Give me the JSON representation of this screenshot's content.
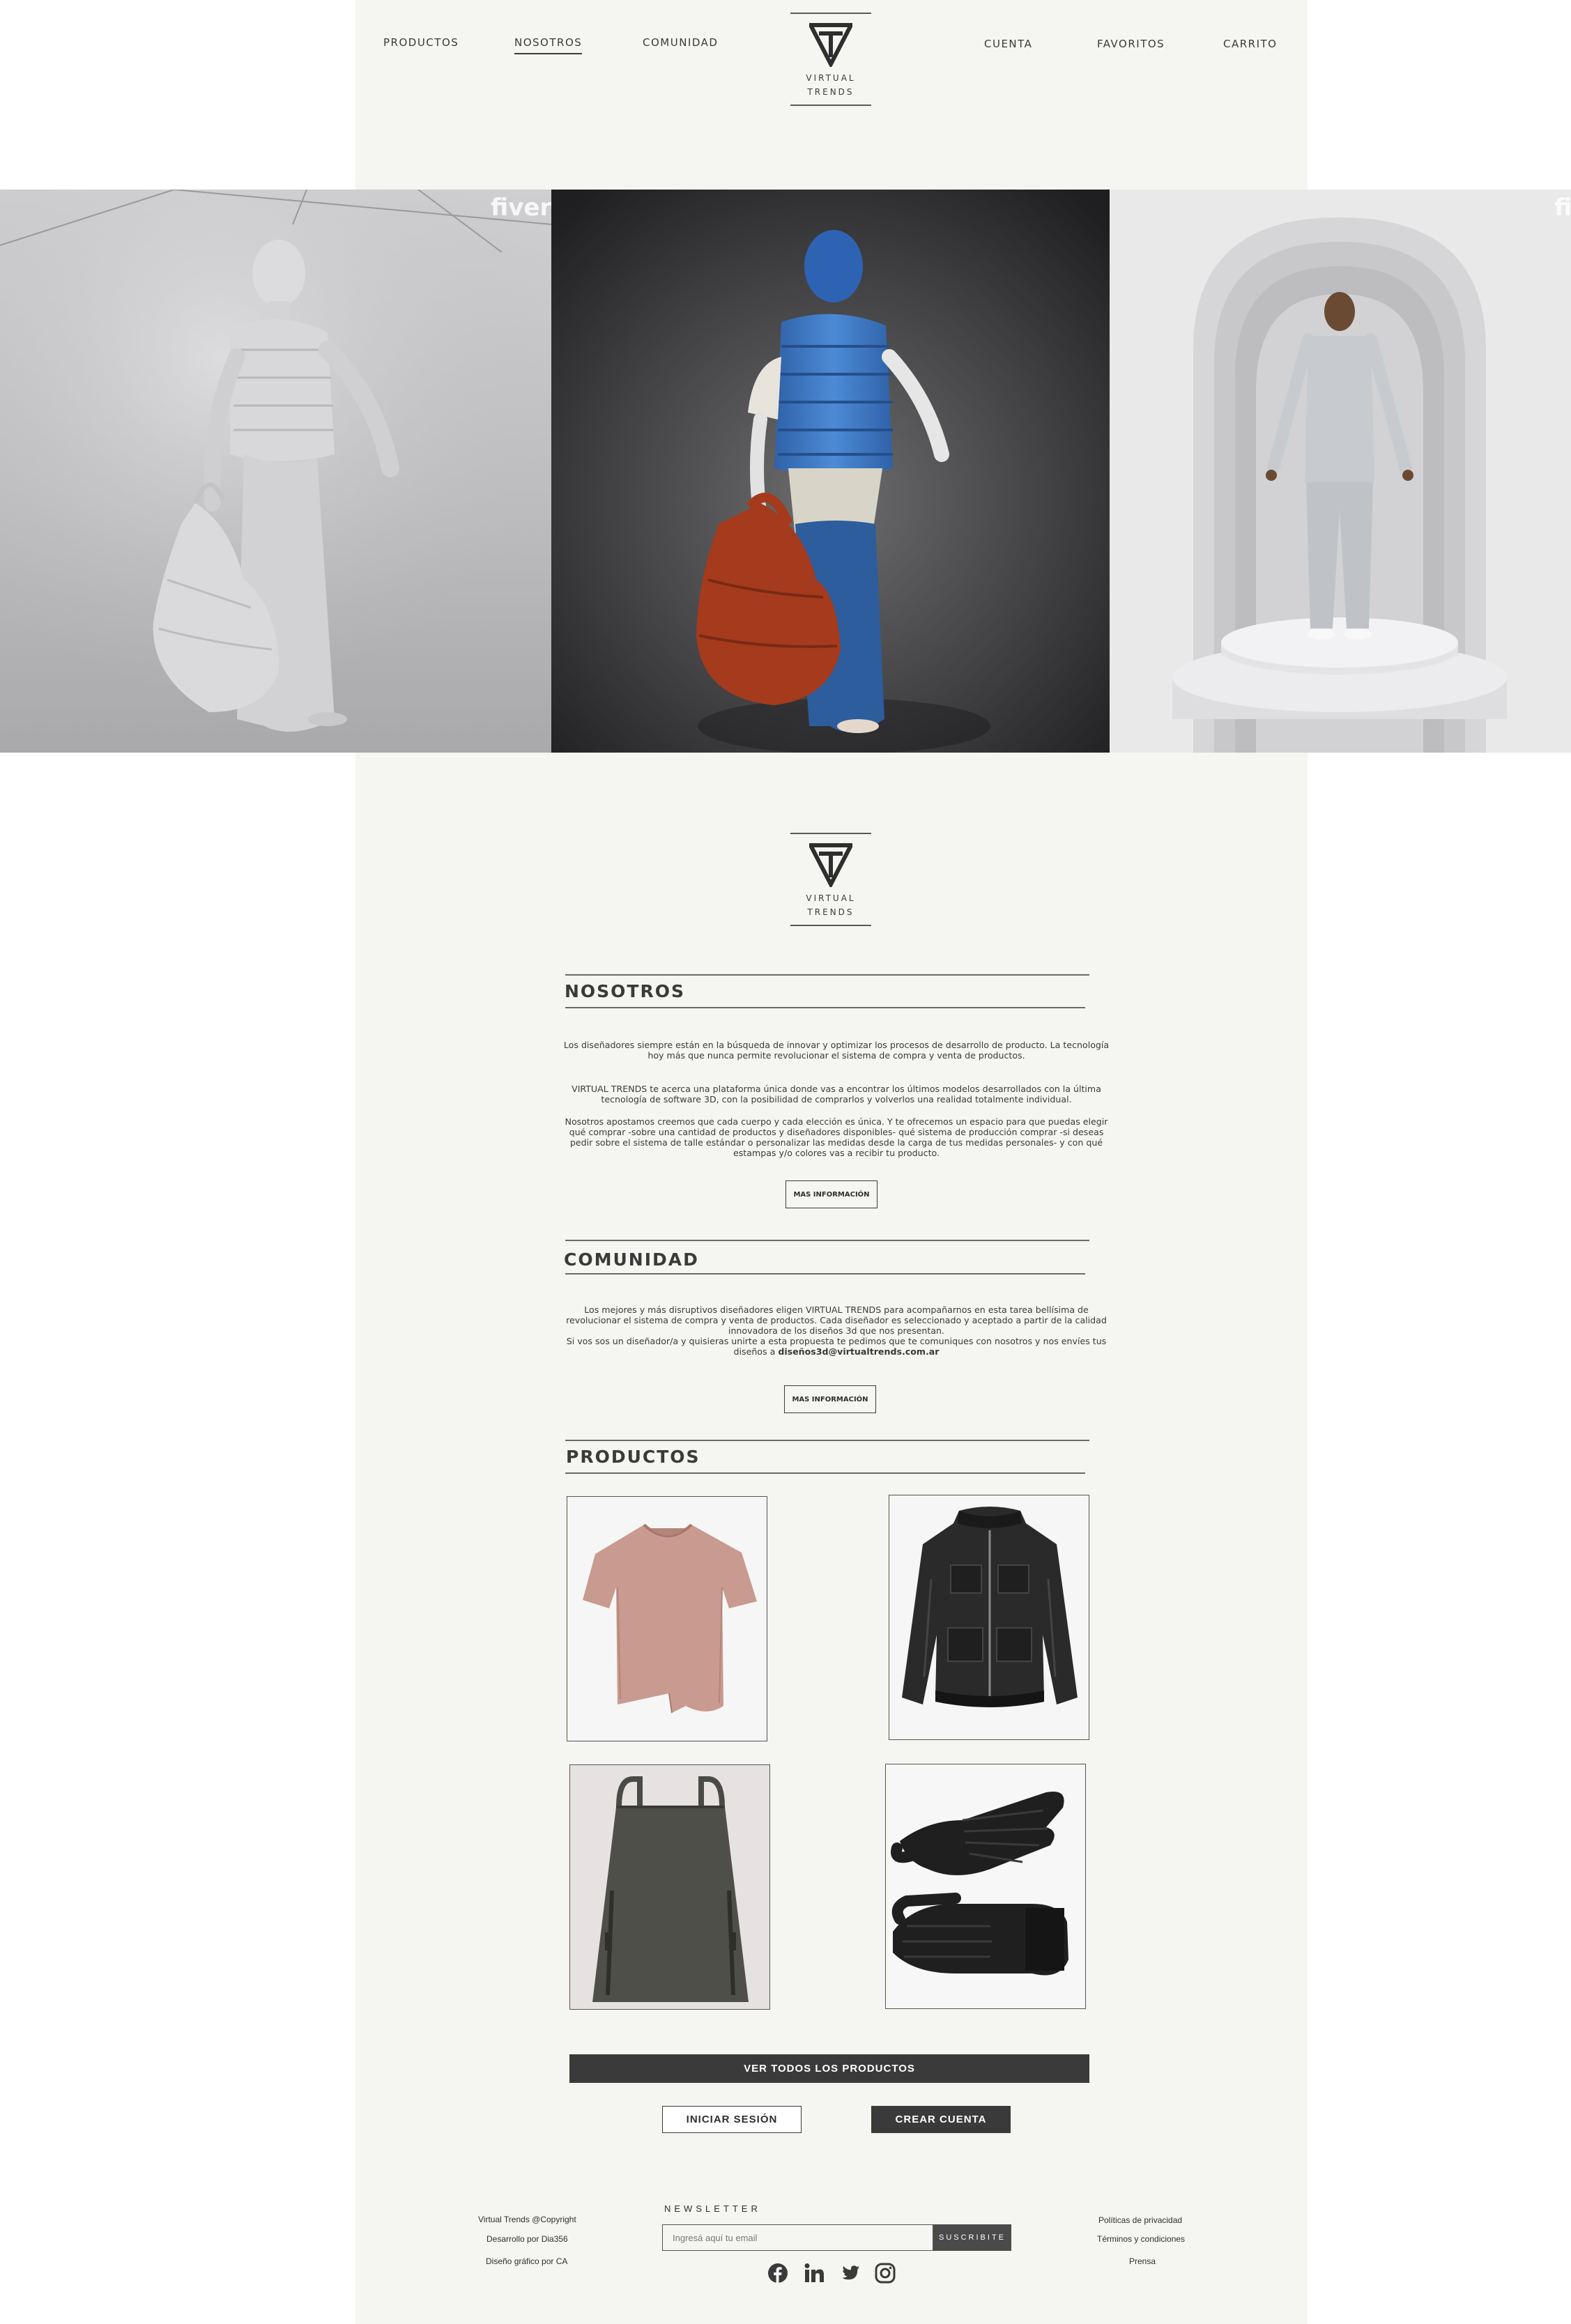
{
  "nav": {
    "left": [
      "PRODUCTOS",
      "NOSOTROS",
      "COMUNIDAD"
    ],
    "right": [
      "CUENTA",
      "FAVORITOS",
      "CARRITO"
    ],
    "active": "NOSOTROS"
  },
  "logo": {
    "line1": "VIRTUAL",
    "line2": "TRENDS"
  },
  "hero": {
    "watermark": "fiverr."
  },
  "nosotros": {
    "title": "NOSOTROS",
    "p1": "Los diseñadores siempre están en la búsqueda de innovar y optimizar los procesos de desarrollo de producto. La tecnología hoy más que nunca permite revolucionar el sistema de compra y venta de productos.",
    "p2": "VIRTUAL TRENDS te acerca una plataforma única donde vas a encontrar los últimos modelos desarrollados con la última tecnología de software 3D, con la posibilidad de comprarlos y volverlos una realidad totalmente individual.",
    "p3": "Nosotros apostamos creemos que cada cuerpo y cada elección es única. Y te ofrecemos un espacio para que puedas elegir qué comprar -sobre una cantidad de productos y diseñadores disponibles- qué sistema de producción comprar -si deseas pedir sobre el sistema de talle estándar o personalizar las medidas desde la carga de tus medidas personales- y con qué estampas y/o colores vas a recibir tu producto.",
    "button": "MAS INFORMACIÓN"
  },
  "comunidad": {
    "title": "COMUNIDAD",
    "p1": "Los mejores y más disruptivos diseñadores eligen VIRTUAL TRENDS para acompañarnos en esta tarea bellísima de revolucionar el sistema de compra y venta de productos. Cada diseñador es seleccionado y aceptado a partir de la calidad innovadora de los diseños 3d que nos presentan.",
    "p2": "Si vos sos un diseñador/a y quisieras unirte a esta propuesta te pedimos que te comuniques con nosotros y nos envíes tus diseños a",
    "email": "diseños3d@virtualtrends.com.ar",
    "button": "MAS INFORMACIÓN"
  },
  "productos": {
    "title": "PRODUCTOS",
    "items": [
      "t-shirt",
      "leather-jacket",
      "backpack",
      "gloves"
    ],
    "view_all": "VER TODOS LOS PRODUCTOS"
  },
  "auth": {
    "login": "INICIAR SESIÓN",
    "signup": "CREAR CUENTA"
  },
  "footer": {
    "left": [
      "Virtual Trends @Copyright",
      "Desarrollo por Dia356",
      "Diseño gráfico por CA"
    ],
    "newsletter_title": "NEWSLETTER",
    "newsletter_placeholder": "Ingresá aquí tu email",
    "newsletter_button": "SUSCRIBITE",
    "right": [
      "Políticas de privacidad",
      "Términos y condiciones",
      "Prensa"
    ],
    "social": [
      "facebook-icon",
      "linkedin-icon",
      "twitter-icon",
      "instagram-icon"
    ]
  },
  "colors": {
    "paper": "#f5f5f1",
    "dark": "#3a3a3a",
    "jacket_blue": "#3c78c8",
    "bag_orange": "#a8391c"
  }
}
